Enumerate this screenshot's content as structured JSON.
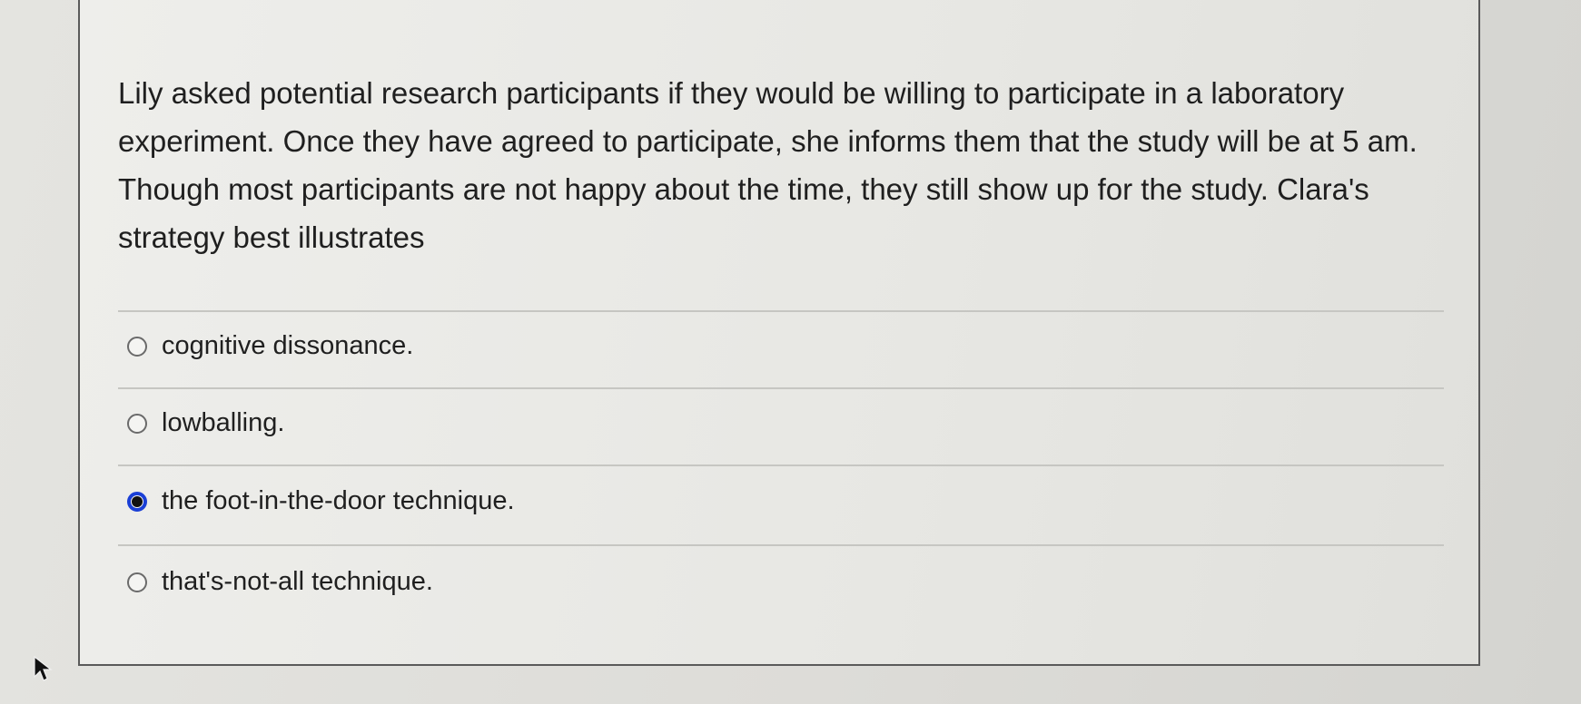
{
  "question": {
    "text": "Lily asked potential research participants if they would be willing to participate in a laboratory experiment. Once they have agreed to participate, she informs them that the study will be at 5 am. Though most participants are not happy about the time, they still show up for the study. Clara's strategy best illustrates"
  },
  "choices": [
    {
      "label": "cognitive dissonance.",
      "selected": false
    },
    {
      "label": "lowballing.",
      "selected": false
    },
    {
      "label": "the foot-in-the-door technique.",
      "selected": true
    },
    {
      "label": "that's-not-all technique.",
      "selected": false
    }
  ],
  "colors": {
    "selected_radio": "#1a3fd6",
    "text": "#1f1f1f"
  },
  "icons": {
    "pointer": "mouse-pointer-icon"
  }
}
